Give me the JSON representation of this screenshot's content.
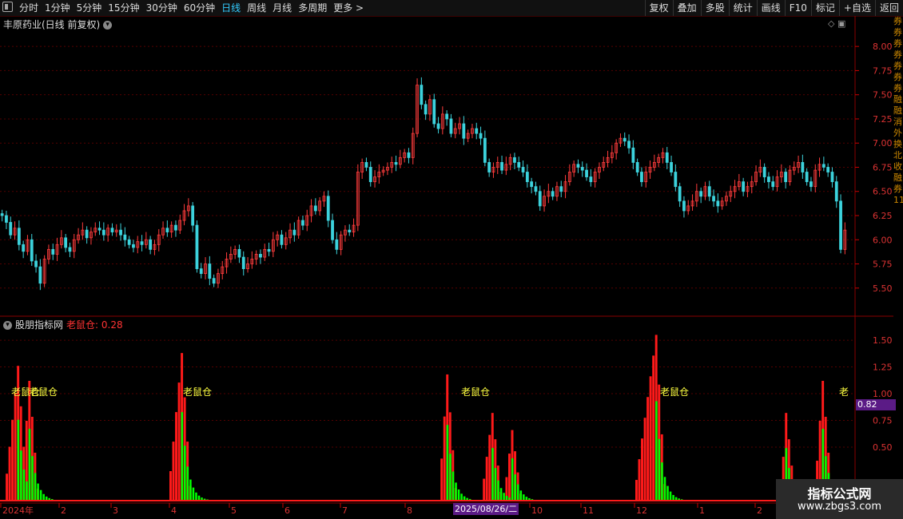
{
  "toolbar": {
    "periods": [
      "分时",
      "1分钟",
      "5分钟",
      "15分钟",
      "30分钟",
      "60分钟",
      "日线",
      "周线",
      "月线",
      "多周期",
      "更多 >"
    ],
    "active_period": "日线",
    "right_buttons": [
      "复权",
      "叠加",
      "多股",
      "统计",
      "画线",
      "F10",
      "标记",
      "+自选",
      "返回"
    ]
  },
  "stock": {
    "title": "丰原药业(日线 前复权)"
  },
  "subchart": {
    "title": "股朋指标网",
    "indicator_name": "老鼠仓:",
    "indicator_value": "0.28",
    "highlight_value": "0.82"
  },
  "watermark": {
    "line1": "指标公式网",
    "line2": "www.zbgs3.com"
  },
  "xaxis": {
    "labels": [
      "2024年",
      "2",
      "3",
      "4",
      "5",
      "6",
      "7",
      "8",
      "2025/08/26/二",
      "10",
      "11",
      "12",
      "1",
      "2"
    ]
  },
  "right_strip_text": "券券券券券券券融融消外换北收融券11111",
  "colors": {
    "up": "#ff3c3c",
    "down": "#3cd2dc",
    "bg": "#000000",
    "grid": "#550000",
    "label": "#ffff40",
    "green": "#00ff00"
  },
  "chart_data": [
    {
      "type": "candlestick",
      "title": "丰原药业(日线 前复权)",
      "ylim": [
        5.3,
        8.15
      ],
      "y_ticks": [
        5.5,
        5.75,
        6.0,
        6.25,
        6.5,
        6.75,
        7.0,
        7.25,
        7.5,
        7.75,
        8.0
      ],
      "closes": [
        6.25,
        6.18,
        6.05,
        6.12,
        5.95,
        5.88,
        6.0,
        5.78,
        5.72,
        5.55,
        5.8,
        5.9,
        5.85,
        5.95,
        6.02,
        5.92,
        5.88,
        6.0,
        6.05,
        6.1,
        6.02,
        6.08,
        6.12,
        6.1,
        6.05,
        6.12,
        6.08,
        6.1,
        6.05,
        6.0,
        5.95,
        5.92,
        5.98,
        5.95,
        6.0,
        5.9,
        5.95,
        6.05,
        6.12,
        6.08,
        6.15,
        6.1,
        6.2,
        6.3,
        6.35,
        6.15,
        5.7,
        5.65,
        5.75,
        5.6,
        5.55,
        5.65,
        5.72,
        5.8,
        5.85,
        5.9,
        5.82,
        5.7,
        5.75,
        5.8,
        5.85,
        5.82,
        5.9,
        5.88,
        6.0,
        6.05,
        5.95,
        6.02,
        6.1,
        6.05,
        6.2,
        6.15,
        6.25,
        6.35,
        6.3,
        6.4,
        6.45,
        6.2,
        6.0,
        5.9,
        6.05,
        6.1,
        6.08,
        6.15,
        6.7,
        6.8,
        6.75,
        6.6,
        6.65,
        6.7,
        6.72,
        6.75,
        6.8,
        6.78,
        6.85,
        6.9,
        6.85,
        7.1,
        7.6,
        7.4,
        7.3,
        7.45,
        7.2,
        7.15,
        7.3,
        7.25,
        7.1,
        7.15,
        7.2,
        7.05,
        7.1,
        7.15,
        7.1,
        7.05,
        6.8,
        6.7,
        6.75,
        6.8,
        6.72,
        6.78,
        6.85,
        6.8,
        6.75,
        6.7,
        6.6,
        6.55,
        6.5,
        6.35,
        6.45,
        6.5,
        6.45,
        6.55,
        6.5,
        6.6,
        6.7,
        6.78,
        6.75,
        6.72,
        6.65,
        6.6,
        6.7,
        6.75,
        6.8,
        6.85,
        6.9,
        7.0,
        7.05,
        7.02,
        6.95,
        6.8,
        6.7,
        6.6,
        6.7,
        6.75,
        6.8,
        6.85,
        6.9,
        6.8,
        6.7,
        6.55,
        6.4,
        6.3,
        6.35,
        6.4,
        6.5,
        6.45,
        6.55,
        6.45,
        6.4,
        6.35,
        6.4,
        6.45,
        6.5,
        6.55,
        6.6,
        6.5,
        6.55,
        6.6,
        6.7,
        6.75,
        6.65,
        6.6,
        6.55,
        6.65,
        6.7,
        6.6,
        6.72,
        6.75,
        6.8,
        6.7,
        6.6,
        6.55,
        6.72,
        6.78,
        6.75,
        6.7,
        6.6,
        6.4,
        5.9,
        6.1
      ]
    },
    {
      "type": "bar",
      "title": "老鼠仓",
      "ylim": [
        0,
        1.62
      ],
      "y_ticks": [
        0.5,
        0.75,
        1.0,
        1.25,
        1.5
      ],
      "peaks": [
        {
          "start": 2,
          "peak": 6,
          "value": 1.26
        },
        {
          "start": 8,
          "peak": 10,
          "value": 1.12
        },
        {
          "start": 60,
          "peak": 64,
          "value": 1.38
        },
        {
          "start": 156,
          "peak": 158,
          "value": 1.18
        },
        {
          "start": 171,
          "peak": 174,
          "value": 0.82
        },
        {
          "start": 179,
          "peak": 181,
          "value": 0.66
        },
        {
          "start": 225,
          "peak": 232,
          "value": 1.55
        },
        {
          "start": 277,
          "peak": 278,
          "value": 0.82
        },
        {
          "start": 289,
          "peak": 291,
          "value": 1.12
        }
      ],
      "labels": [
        "老鼠仓",
        "老鼠仓",
        "老鼠仓",
        "老鼠仓",
        "老鼠仓",
        "老"
      ]
    }
  ]
}
